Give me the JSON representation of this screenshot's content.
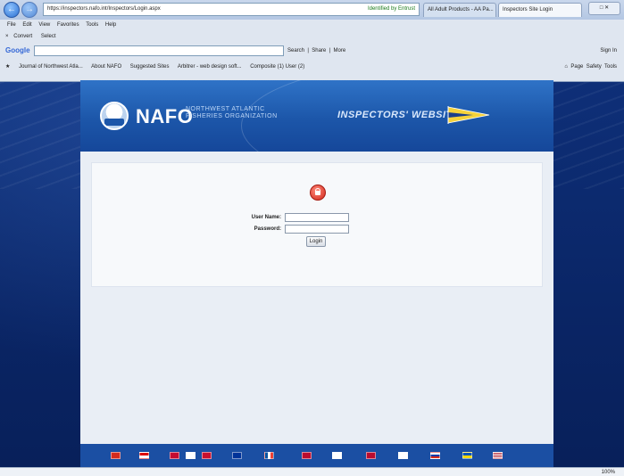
{
  "browser": {
    "address_url": "https://inspectors.nafo.int/Inspectors/Login.aspx",
    "cert_label": "Identified by Entrust",
    "tabs": [
      {
        "label": "All Adult Products - AA Pa..."
      },
      {
        "label": "Inspectors Site Login"
      }
    ],
    "menu": [
      "File",
      "Edit",
      "View",
      "Favorites",
      "Tools",
      "Help"
    ],
    "linkbar": [
      "Convert",
      "Select"
    ],
    "google": {
      "logo": "Google",
      "search_label": "Search",
      "share_label": "Share",
      "more_label": "More",
      "signin_label": "Sign In"
    },
    "favorites": [
      "Journal of Northwest Atla...",
      "About NAFO",
      "Suggested Sites",
      "Arbitrer - web design soft...",
      "Composite (1) User (2)"
    ],
    "commands": [
      "Page",
      "Safety",
      "Tools"
    ],
    "status_zoom": "100%"
  },
  "site": {
    "logo_text": "NAFO",
    "logo_sub_line1": "NORTHWEST ATLANTIC",
    "logo_sub_line2": "FISHERIES ORGANIZATION",
    "banner_title": "INSPECTORS' WEBSITE",
    "form": {
      "username_label": "User Name:",
      "password_label": "Password:",
      "username_value": "",
      "password_value": "",
      "login_label": "Login"
    }
  },
  "colors": {
    "banner": "#1c56a9",
    "page_bg": "#0b2a6e",
    "lock_red": "#d0261a"
  }
}
